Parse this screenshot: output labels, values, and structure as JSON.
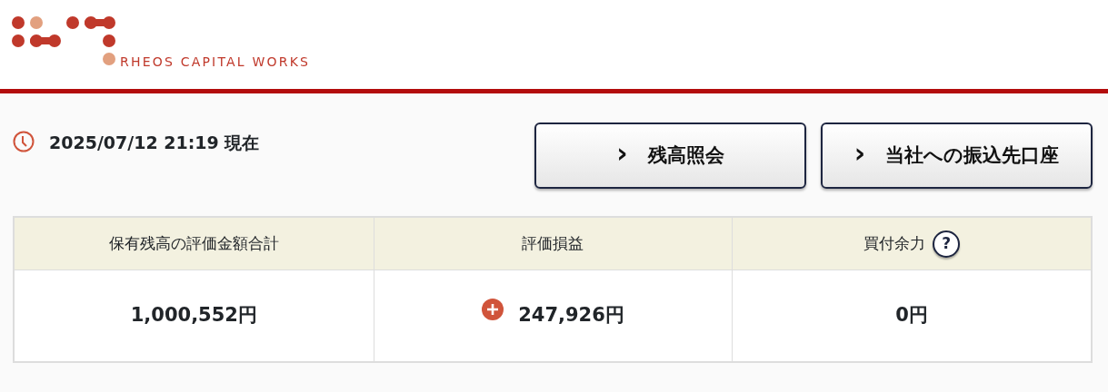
{
  "logo": {
    "text": "RHEOS CAPITAL WORKS"
  },
  "as_of": {
    "text": "2025/07/12 21:19 現在"
  },
  "buttons": [
    {
      "chevron": "›",
      "label": "残高照会"
    },
    {
      "chevron": "›",
      "label": "当社への振込先口座"
    }
  ],
  "summary": [
    {
      "heading": "保有残高の評価金額合計",
      "value": "1,000,552円"
    },
    {
      "heading": "評価損益",
      "value": "247,926円",
      "gain": true
    },
    {
      "heading": "買付余力",
      "value": "0円",
      "help": "?"
    }
  ]
}
